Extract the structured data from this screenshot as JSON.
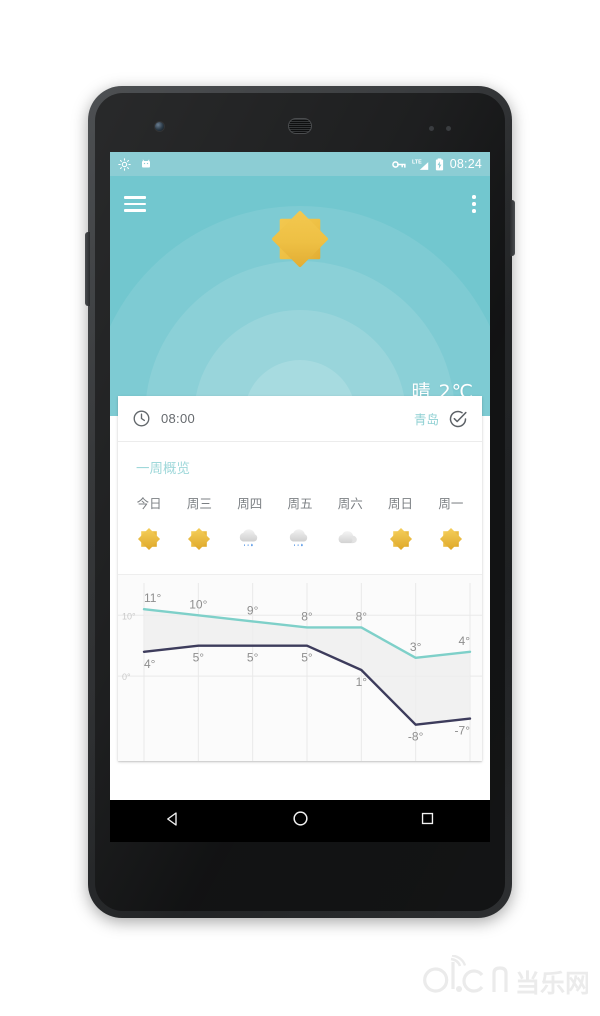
{
  "device": {
    "frame": "nexus-phone",
    "hardware": {
      "front_camera": "front-camera",
      "earpiece": "earpiece-speaker",
      "power_button": "power-button",
      "volume_button": "volume-button"
    }
  },
  "statusbar": {
    "left_icons": [
      "brightness-icon",
      "android-notification-icon"
    ],
    "right_icons": [
      "vpn-key-icon",
      "lte-signal-icon",
      "battery-charging-icon"
    ],
    "lte_label": "LTE",
    "time": "08:24"
  },
  "appbar": {
    "menu_icon": "hamburger-menu-icon",
    "overflow_icon": "overflow-menu-icon"
  },
  "hero": {
    "weather_icon": "sun-icon",
    "condition": "晴",
    "temperature": "2℃",
    "condition_line": "晴 2℃",
    "bg_color": "#72c7cf"
  },
  "card": {
    "clock_icon": "clock-icon",
    "time": "08:00",
    "city": "青岛",
    "check_icon": "check-circle-icon",
    "section_title": "一周概览"
  },
  "forecast": {
    "days": [
      {
        "label": "今日",
        "icon": "sun-icon",
        "high": 11,
        "low": 4
      },
      {
        "label": "周三",
        "icon": "sun-icon",
        "high": 10,
        "low": 5
      },
      {
        "label": "周四",
        "icon": "rain-icon",
        "high": 9,
        "low": 5
      },
      {
        "label": "周五",
        "icon": "rain-icon",
        "high": 8,
        "low": 5
      },
      {
        "label": "周六",
        "icon": "cloudy-icon",
        "high": 8,
        "low": 1
      },
      {
        "label": "周日",
        "icon": "sun-icon",
        "high": 3,
        "low": -8
      },
      {
        "label": "周一",
        "icon": "sun-icon",
        "high": 4,
        "low": -7
      }
    ]
  },
  "chart_data": {
    "type": "line",
    "title": "一周概览",
    "xlabel": "",
    "ylabel": "",
    "categories": [
      "今日",
      "周三",
      "周四",
      "周五",
      "周六",
      "周日",
      "周一"
    ],
    "series": [
      {
        "name": "high",
        "color": "#7ed0c9",
        "values": [
          11,
          10,
          9,
          8,
          8,
          3,
          4
        ],
        "labels": [
          "11°",
          "10°",
          "9°",
          "8°",
          "8°",
          "3°",
          "4°"
        ]
      },
      {
        "name": "low",
        "color": "#3d3c5c",
        "values": [
          4,
          5,
          5,
          5,
          1,
          -8,
          -7
        ],
        "labels": [
          "4°",
          "5°",
          "5°",
          "5°",
          "1°",
          "-8°",
          "-7°"
        ]
      }
    ],
    "ylim": [
      -12,
      14
    ],
    "yticks": [
      0,
      10
    ],
    "ytick_labels": [
      "0°",
      "10°"
    ],
    "grid": true,
    "legend": "none",
    "band_fill": "#ededed"
  },
  "navbar": {
    "back": "back-triangle-icon",
    "home": "home-circle-icon",
    "recents": "recents-square-icon"
  },
  "watermark": {
    "text": "d.cn当乐网"
  }
}
